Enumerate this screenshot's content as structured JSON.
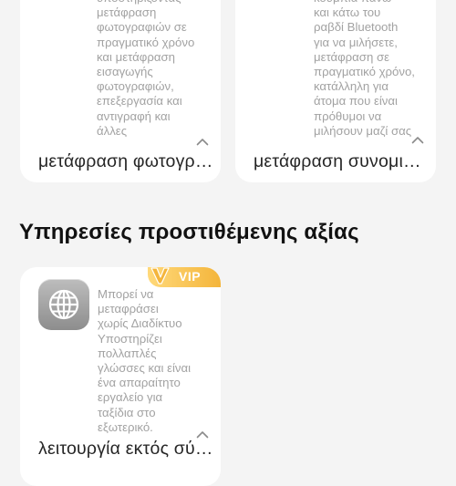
{
  "cards_top": [
    {
      "description": "υποστηρίζοντας\nμετάφραση\nφωτογραφιών σε\nπραγματικό χρόνο\nκαι μετάφραση\nεισαγωγής\nφωτογραφιών,\nεπεξεργασία και\nαντιγραφή και\nάλλες",
      "title": "μετάφραση φωτογραφιών"
    },
    {
      "description": "κουμπιά πάνω\nκαι κάτω του\nραβδί Bluetooth\nγια να μιλήσετε,\nμετάφραση σε\nπραγματικό χρόνο,\nκατάλληλη για\nάτομα που είναι\nπρόθυμοι να\nμιλήσουν μαζί σας",
      "title": "μετάφραση συνομιλίας"
    }
  ],
  "section": {
    "heading": "Υπηρεσίες προστιθέμενης αξίας"
  },
  "offline_card": {
    "badge": "VIP",
    "icon": "globe-icon",
    "description": "Μπορεί να\nμεταφράσει\nχωρίς Διαδίκτυο\nΥποστηρίζει\nπολλαπλές\nγλώσσες και είναι\nένα απαραίτητο\nεργαλείο για\nταξίδια στο\nεξωτερικό.",
    "title": "λειτουργία εκτός σύνδεσης"
  },
  "colors": {
    "background": "#f4f4f4",
    "card": "#ffffff",
    "description_text": "#a2a2a2",
    "title_text": "#262626",
    "vip_gold": "#f4b53b"
  }
}
